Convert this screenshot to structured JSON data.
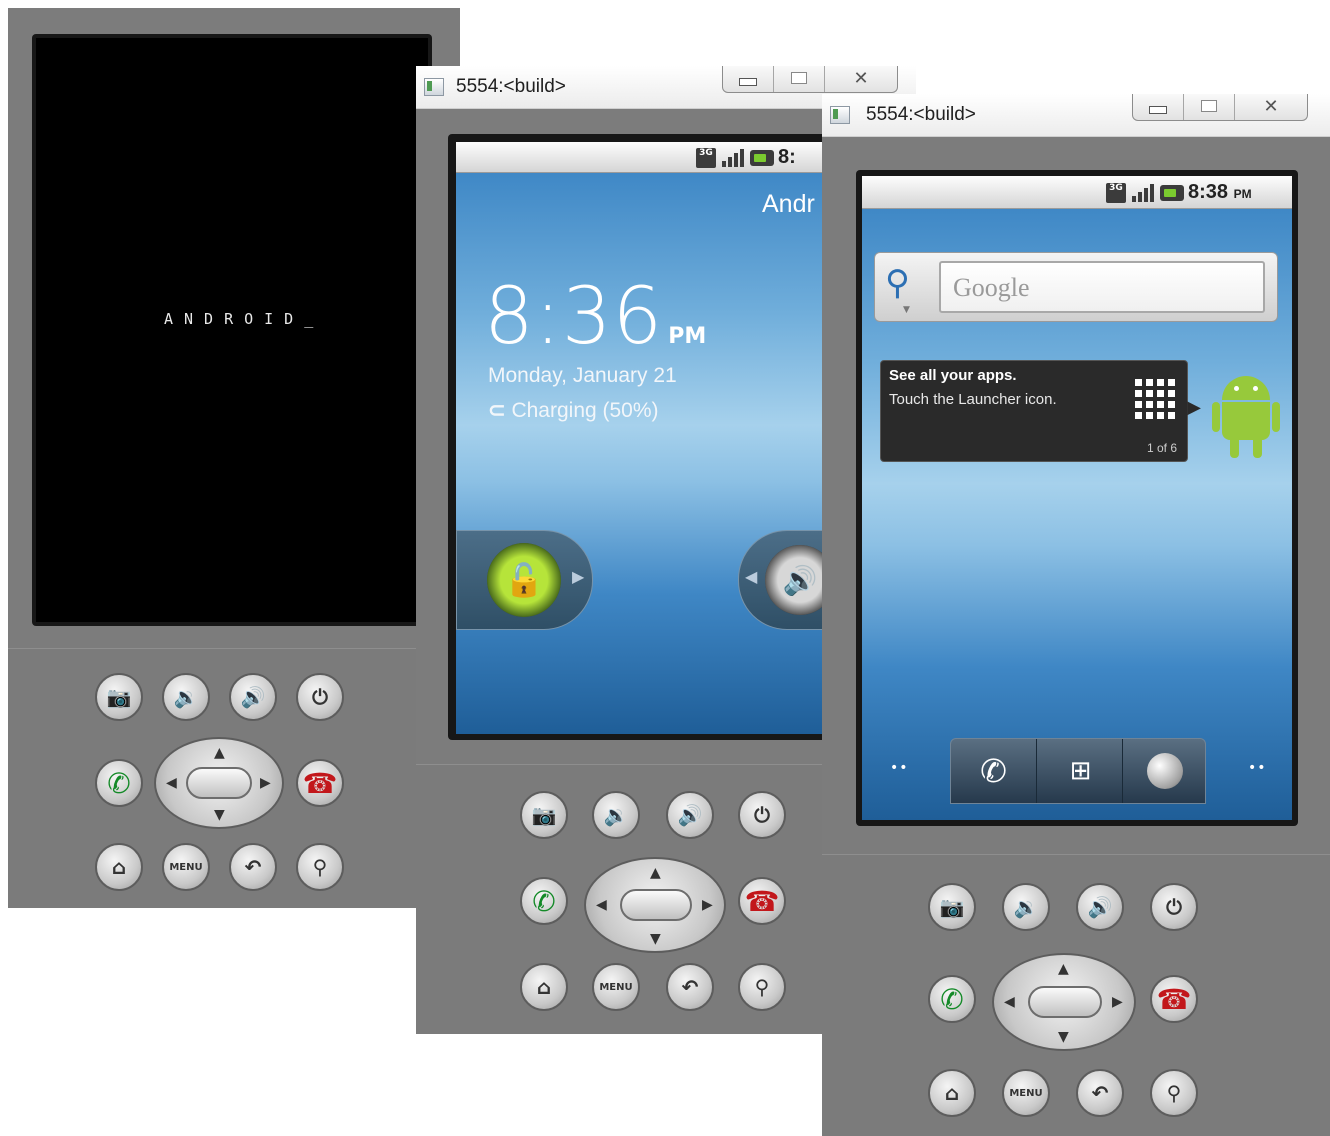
{
  "colors": {
    "phone_body": "#7c7c7c",
    "bezel": "#171717",
    "call_green": "#148a28",
    "end_red": "#c2171b",
    "unlock_green": "#b6e43a"
  },
  "emulator_boot": {
    "boot_text": "ANDROID_"
  },
  "emulator_lock": {
    "window_title": "5554:<build>",
    "status_time": "8:",
    "carrier_partial": "Andr",
    "clock_time": "8:36",
    "clock_ampm": "PM",
    "date": "Monday, January 21",
    "charging": "Charging (50%)"
  },
  "emulator_home": {
    "window_title": "5554:<build>",
    "status_time": "8:38",
    "status_ampm": "PM",
    "search_placeholder": "Google",
    "tip_title": "See all your apps.",
    "tip_body": "Touch the Launcher icon.",
    "tip_page": "1 of 6"
  },
  "controls": {
    "menu_label": "MENU"
  },
  "icons": [
    "camera-icon",
    "volume-down-icon",
    "volume-up-icon",
    "power-icon",
    "call-icon",
    "end-call-icon",
    "home-icon",
    "menu-icon",
    "back-icon",
    "search-icon",
    "dpad-icon",
    "lock-icon",
    "sound-icon",
    "launcher-icon",
    "browser-icon",
    "android-robot-icon"
  ]
}
